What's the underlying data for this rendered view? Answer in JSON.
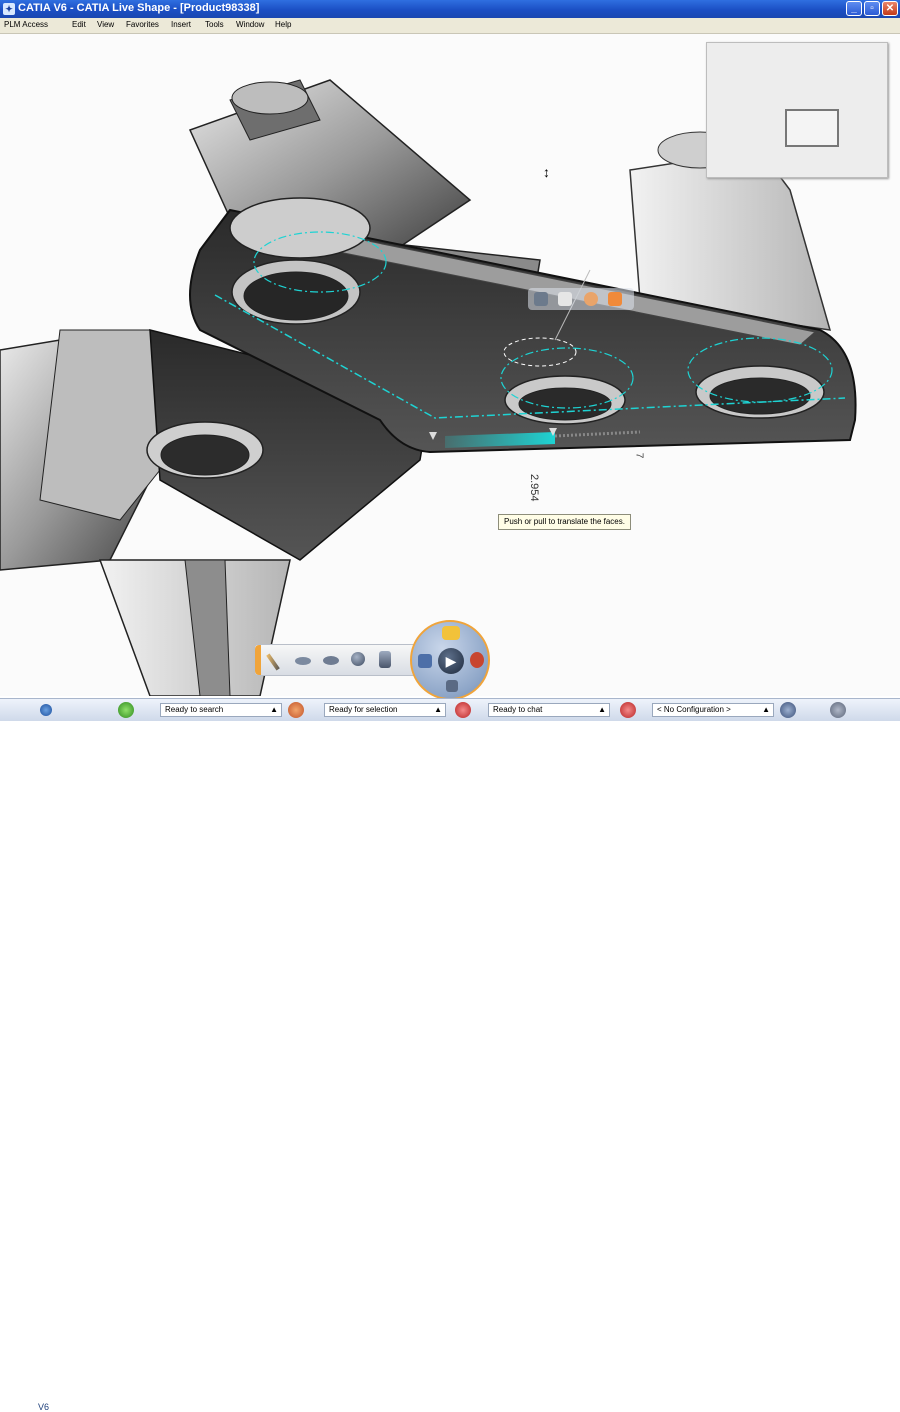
{
  "window": {
    "title": "CATIA V6 - CATIA Live Shape - [Product98338]",
    "app_icon": "catia-app-icon"
  },
  "menu": {
    "items": [
      "PLM Access",
      "Edit",
      "View",
      "Favorites",
      "Insert",
      "Tools",
      "Window",
      "Help"
    ]
  },
  "viewport": {
    "tooltip": "Push or pull to translate the faces.",
    "dimension_value": "2.954",
    "dimension_partial": "7"
  },
  "status": {
    "app_label": "V6",
    "search_field": "Ready to search",
    "selection_field": "Ready for selection",
    "chat_field": "Ready to chat",
    "configuration_field": "< No Configuration >"
  },
  "colors": {
    "title_bar": "#1b4fc4",
    "accent_orange": "#f0a43a",
    "feedback_cyan": "#1ed3d3"
  }
}
